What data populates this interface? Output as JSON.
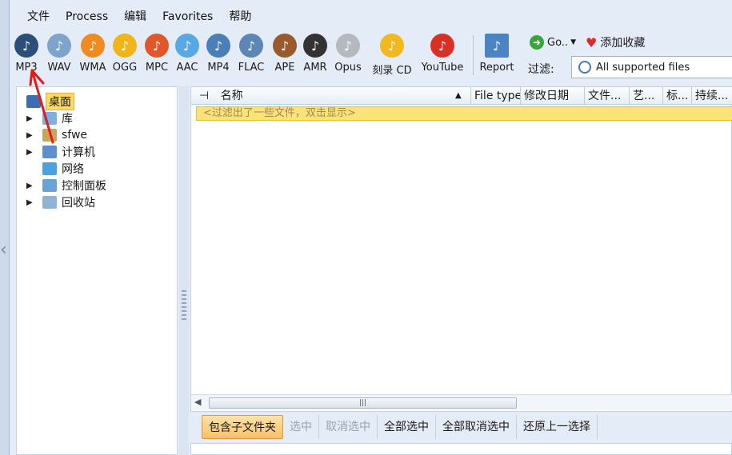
{
  "menu": [
    "文件",
    "Process",
    "编辑",
    "Favorites",
    "帮助"
  ],
  "toolbar": [
    {
      "label": "MP3",
      "icon": "mp3-icon",
      "color": "#2c4f7a"
    },
    {
      "label": "WAV",
      "icon": "wav-icon",
      "color": "#7ea3cc"
    },
    {
      "label": "WMA",
      "icon": "wma-icon",
      "color": "#f08b21"
    },
    {
      "label": "OGG",
      "icon": "ogg-icon",
      "color": "#f1b51c"
    },
    {
      "label": "MPC",
      "icon": "mpc-icon",
      "color": "#e0582a"
    },
    {
      "label": "AAC",
      "icon": "aac-icon",
      "color": "#57a8e5"
    },
    {
      "label": "MP4",
      "icon": "mp4-icon",
      "color": "#4a7fb8"
    },
    {
      "label": "FLAC",
      "icon": "flac-icon",
      "color": "#5b86b6"
    },
    {
      "label": "APE",
      "icon": "ape-icon",
      "color": "#9a5a2b"
    },
    {
      "label": "AMR",
      "icon": "amr-icon",
      "color": "#333333"
    },
    {
      "label": "Opus",
      "icon": "opus-icon",
      "color": "#b5b9be"
    },
    {
      "label": "刻录 CD",
      "icon": "burn-cd-icon",
      "color": "#f2b820"
    },
    {
      "label": "YouTube",
      "icon": "youtube-icon",
      "color": "#d93025"
    },
    {
      "label": "Report",
      "icon": "report-icon",
      "color": "#4a84c4"
    }
  ],
  "go_label": "Go..",
  "favorites_label": "添加收藏",
  "filter_label": "过滤:",
  "filter_value": "All supported files",
  "tree": [
    {
      "label": "桌面",
      "selected": true,
      "expandable": false,
      "icon": "desktop-icon",
      "indent": 0
    },
    {
      "label": "库",
      "selected": false,
      "expandable": true,
      "icon": "library-icon",
      "indent": 1
    },
    {
      "label": "sfwe",
      "selected": false,
      "expandable": true,
      "icon": "user-folder-icon",
      "indent": 1
    },
    {
      "label": "计算机",
      "selected": false,
      "expandable": true,
      "icon": "computer-icon",
      "indent": 1
    },
    {
      "label": "网络",
      "selected": false,
      "expandable": false,
      "icon": "network-icon",
      "indent": 1
    },
    {
      "label": "控制面板",
      "selected": false,
      "expandable": true,
      "icon": "control-panel-icon",
      "indent": 1
    },
    {
      "label": "回收站",
      "selected": false,
      "expandable": true,
      "icon": "recycle-bin-icon",
      "indent": 1
    }
  ],
  "columns": [
    "名称",
    "File type",
    "修改日期",
    "文件...",
    "艺...",
    "标...",
    "持续..."
  ],
  "filtered_notice": "<过滤出了一些文件，双击显示>",
  "bottom": [
    {
      "label": "包含子文件夹",
      "state": "active"
    },
    {
      "label": "选中",
      "state": "dim"
    },
    {
      "label": "取消选中",
      "state": "dim"
    },
    {
      "label": "全部选中",
      "state": "normal"
    },
    {
      "label": "全部取消选中",
      "state": "normal"
    },
    {
      "label": "还原上一选择",
      "state": "normal"
    }
  ]
}
